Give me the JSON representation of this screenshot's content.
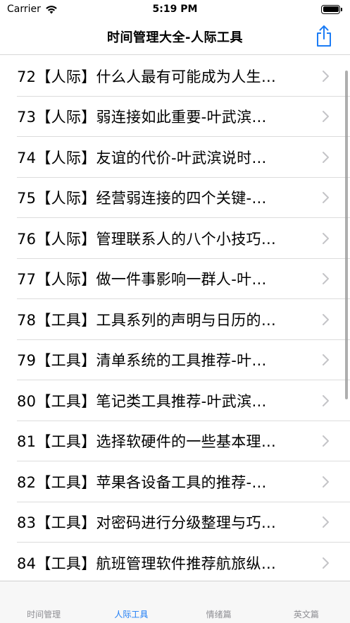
{
  "status_bar": {
    "carrier": "Carrier",
    "time": "5:19 PM"
  },
  "nav": {
    "title": "时间管理大全-人际工具",
    "share_icon": "share-icon"
  },
  "list": {
    "items": [
      {
        "label": "72【人际】什么人最有可能成为人生…"
      },
      {
        "label": "73【人际】弱连接如此重要-叶武滨…"
      },
      {
        "label": "74【人际】友谊的代价-叶武滨说时…"
      },
      {
        "label": "75【人际】经营弱连接的四个关键-…"
      },
      {
        "label": "76【人际】管理联系人的八个小技巧…"
      },
      {
        "label": "77【人际】做一件事影响一群人-叶…"
      },
      {
        "label": "78【工具】工具系列的声明与日历的…"
      },
      {
        "label": "79【工具】清单系统的工具推荐-叶…"
      },
      {
        "label": "80【工具】笔记类工具推荐-叶武滨…"
      },
      {
        "label": "81【工具】选择软硬件的一些基本理…"
      },
      {
        "label": "82【工具】苹果各设备工具的推荐-…"
      },
      {
        "label": "83【工具】对密码进行分级整理与巧…"
      },
      {
        "label": "84【工具】航班管理软件推荐航旅纵…"
      }
    ]
  },
  "tabs": [
    {
      "label": "时间管理",
      "active": false
    },
    {
      "label": "人际工具",
      "active": true
    },
    {
      "label": "情绪篇",
      "active": false
    },
    {
      "label": "英文篇",
      "active": false
    }
  ],
  "colors": {
    "accent": "#1c7cf5",
    "inactive_tab": "#8e8e93",
    "chevron": "#c4c4c7"
  }
}
